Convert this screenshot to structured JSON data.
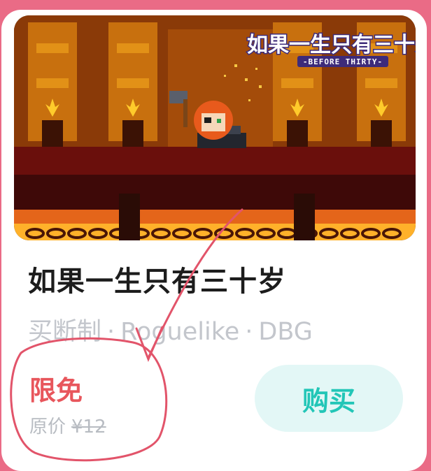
{
  "game": {
    "logo_title": "如果一生只有三十岁",
    "logo_subtitle": "-BEFORE THIRTY-",
    "title": "如果一生只有三十岁",
    "tags": [
      "买断制",
      "Roguelike",
      "DBG"
    ],
    "tag_separator": "·"
  },
  "pricing": {
    "status": "限免",
    "original_label": "原价",
    "original_price": "¥12"
  },
  "actions": {
    "buy_label": "购买"
  },
  "colors": {
    "background": "#ea6b86",
    "free_text": "#e8565c",
    "buy_text": "#22c6b7",
    "buy_bg": "#e3f7f6",
    "annotation": "#e2546a"
  }
}
